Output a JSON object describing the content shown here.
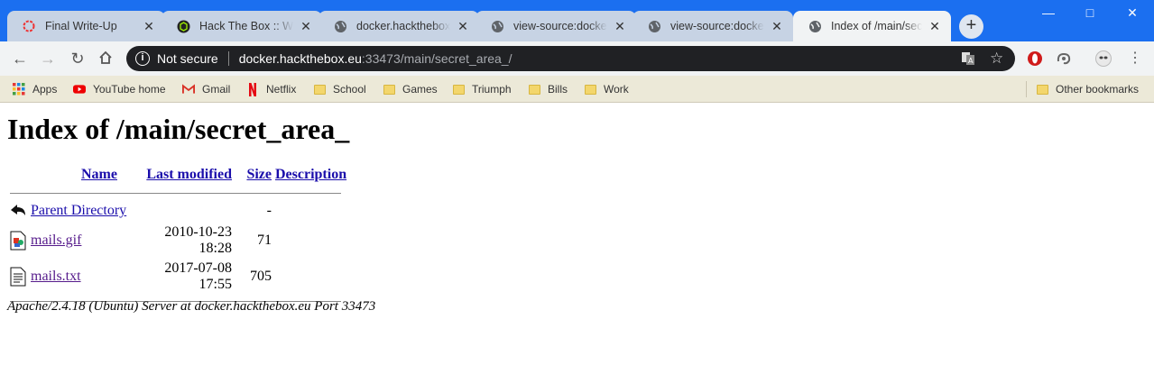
{
  "tabs": [
    {
      "title": "Final Write-Up",
      "icon": "ring-icon"
    },
    {
      "title": "Hack The Box :: Website",
      "icon": "htb-cube-icon"
    },
    {
      "title": "docker.hackthebox.eu",
      "icon": "globe-icon"
    },
    {
      "title": "view-source:docker.hackthebox.eu",
      "icon": "globe-icon"
    },
    {
      "title": "view-source:docker.hackthebox.eu",
      "icon": "globe-icon"
    },
    {
      "title": "Index of /main/secret_area_",
      "icon": "globe-icon",
      "active": true
    }
  ],
  "toolbar": {
    "security_label": "Not secure",
    "url_host": "docker.hackthebox.eu",
    "url_rest": ":33473/main/secret_area_/"
  },
  "bookmarks": [
    {
      "label": "Apps",
      "icon": "apps-grid-icon"
    },
    {
      "label": "YouTube home",
      "icon": "youtube-icon"
    },
    {
      "label": "Gmail",
      "icon": "gmail-icon"
    },
    {
      "label": "Netflix",
      "icon": "netflix-icon"
    },
    {
      "label": "School",
      "icon": "folder-icon"
    },
    {
      "label": "Games",
      "icon": "folder-icon"
    },
    {
      "label": "Triumph",
      "icon": "folder-icon"
    },
    {
      "label": "Bills",
      "icon": "folder-icon"
    },
    {
      "label": "Work",
      "icon": "folder-icon"
    }
  ],
  "other_bookmarks": "Other bookmarks",
  "page": {
    "heading": "Index of /main/secret_area_",
    "columns": {
      "name": "Name",
      "modified": "Last modified",
      "size": "Size",
      "description": "Description"
    },
    "rows": [
      {
        "name": "Parent Directory",
        "modified": "",
        "size": "-",
        "description": "",
        "icon": "back-arrow-icon"
      },
      {
        "name": "mails.gif",
        "modified": "2010-10-23 18:28",
        "size": "71",
        "description": "",
        "icon": "image-file-icon"
      },
      {
        "name": "mails.txt",
        "modified": "2017-07-08 17:55",
        "size": "705",
        "description": "",
        "icon": "text-file-icon"
      }
    ],
    "address": "Apache/2.4.18 (Ubuntu) Server at docker.hackthebox.eu Port 33473"
  },
  "colors": {
    "titlebar": "#1b6ff0",
    "link": "#1a0dab",
    "visited": "#551a8b",
    "omnibox": "#202124"
  }
}
